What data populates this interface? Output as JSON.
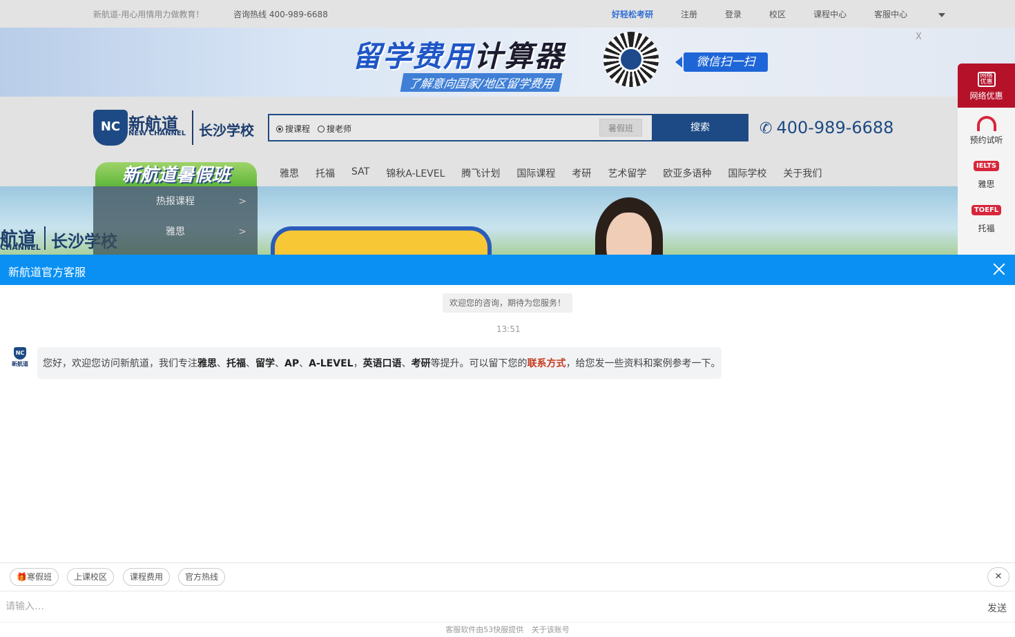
{
  "topbar": {
    "slogan": "新航道-用心用情用力做教育！",
    "hotline": "咨询热线 400-989-6688",
    "nav": [
      "好轻松考研",
      "注册",
      "登录",
      "校区",
      "课程中心",
      "客服中心"
    ]
  },
  "banner": {
    "title_a": "留学费用",
    "title_b": "计算器",
    "subtitle": "了解意向国家/地区留学费用",
    "wechat": "微信扫一扫",
    "close": "X"
  },
  "header": {
    "logo_mark": "NC",
    "logo_cn": "新航道",
    "logo_en": "NEW CHANNEL",
    "school": "长沙学校",
    "search": {
      "options": [
        "搜课程",
        "搜老师"
      ],
      "selected": "搜课程",
      "tag": "暑假班",
      "button": "搜索"
    },
    "phone": "400-989-6688",
    "summer": "新航道暑假班",
    "nav": [
      "雅思",
      "托福",
      "SAT",
      "锦秋A-LEVEL",
      "腾飞计划",
      "国际课程",
      "考研",
      "艺术留学",
      "欧亚多语种",
      "国际学校",
      "关于我们"
    ]
  },
  "hero": {
    "logo_cn": "航道",
    "logo_en": "CHANNEL",
    "school": "长沙学校"
  },
  "leftmenu": [
    {
      "label": "热报课程",
      "arrow": ">"
    },
    {
      "label": "雅思",
      "arrow": ">"
    }
  ],
  "sidebar": [
    {
      "label": "网络优惠",
      "badge": "网络优惠",
      "icon": "gift-icon"
    },
    {
      "label": "预约试听",
      "icon": "headphones-icon"
    },
    {
      "label": "雅思",
      "badge": "IELTS",
      "icon": "ielts-icon"
    },
    {
      "label": "托福",
      "badge": "TOEFL",
      "icon": "toefl-icon"
    }
  ],
  "chat": {
    "title": "新航道官方客服",
    "welcome": "欢迎您的咨询，期待为您服务！",
    "time": "13:51",
    "avatar_mark": "NC",
    "avatar_name": "新航道",
    "message": {
      "p1": "您好，欢迎您访问新航道，我们专注",
      "k1": "雅思",
      "s1": "、",
      "k2": "托福",
      "s2": "、",
      "k3": "留学",
      "s3": "、",
      "k4": "AP",
      "s4": "、",
      "k5": "A-LEVEL",
      "s5": "，",
      "k6": "英语口语",
      "s6": "、",
      "k7": "考研",
      "p2": "等提升。可以留下您的",
      "contact": "联系方式",
      "p3": "，给您发一些资料和案例参考一下。"
    },
    "quick": [
      "🎁寒假班",
      "上课校区",
      "课程费用",
      "官方热线"
    ],
    "quick_close": "✕",
    "input_placeholder": "请输入…",
    "send": "发送",
    "footer": [
      "客服软件由53快服提供",
      "关于该账号"
    ]
  }
}
